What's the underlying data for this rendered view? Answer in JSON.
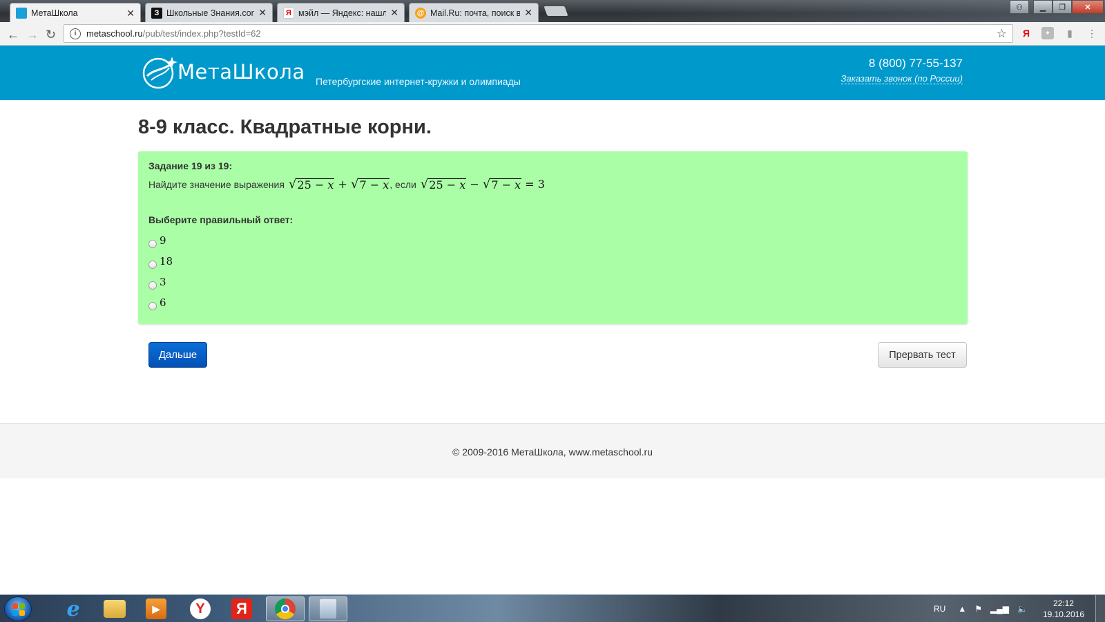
{
  "browser": {
    "tabs": [
      {
        "label": "МетаШкола",
        "icon": "metaschool-favicon"
      },
      {
        "label": "Школьные Знания.com",
        "icon": "znanija-favicon"
      },
      {
        "label": "мэйл — Яндекс: нашлос",
        "icon": "yandex-favicon"
      },
      {
        "label": "Mail.Ru: почта, поиск в",
        "icon": "mailru-favicon"
      }
    ],
    "url_host": "metaschool.ru",
    "url_path": "/pub/test/index.php?testId=62",
    "ext_yandex": "Я"
  },
  "header": {
    "logo_text": "МетаШкола",
    "tagline": "Петербургские интернет-кружки и олимпиады",
    "phone": "8 (800) 77-55-137",
    "callback_link": "Заказать звонок (по России)"
  },
  "page": {
    "title": "8-9 класс. Квадратные корни."
  },
  "task": {
    "number_label": "Задание 19 из 19:",
    "prompt": "Найдите значение выражения",
    "condition_word": ", если",
    "expr1": {
      "a": "25",
      "b": "7"
    },
    "expr2_result": "3",
    "choose_label": "Выберите правильный ответ:",
    "options": [
      "9",
      "18",
      "3",
      "6"
    ]
  },
  "buttons": {
    "next": "Дальше",
    "abort": "Прервать тест"
  },
  "footer": {
    "text": "© 2009-2016 МетаШкола, www.metaschool.ru"
  },
  "taskbar": {
    "lang": "RU",
    "time": "22:12",
    "date": "19.10.2016"
  },
  "colors": {
    "header_bg": "#0099cc",
    "task_bg": "#aaffa6",
    "next_button": "#0a6fd6"
  }
}
